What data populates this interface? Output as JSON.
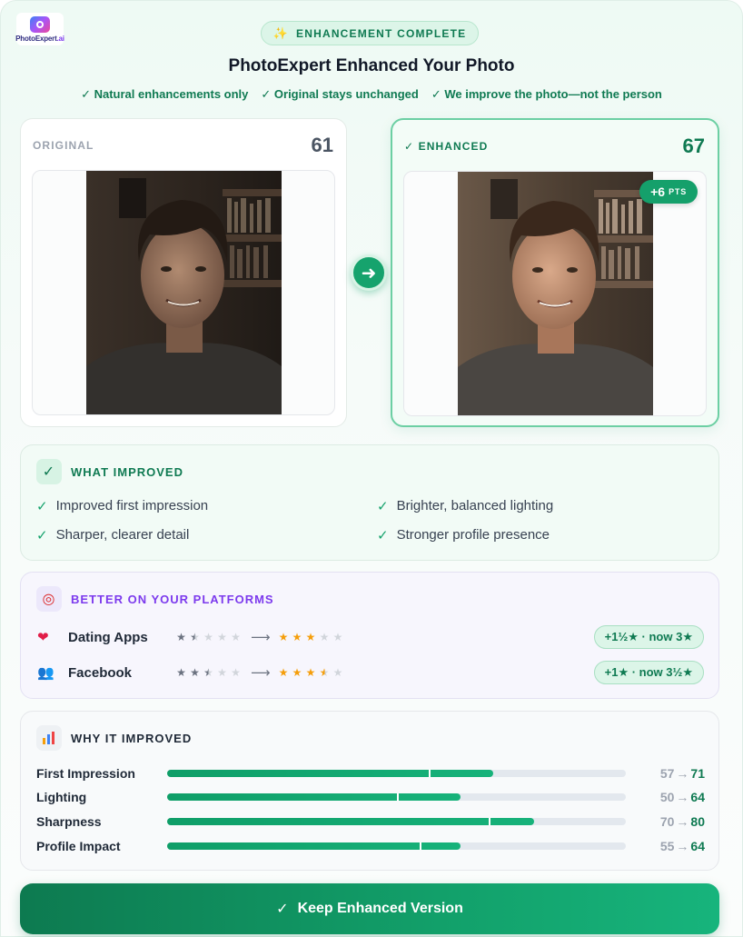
{
  "brand": {
    "logo_text": "PhotoExpert",
    "logo_suffix": ".ai"
  },
  "status_pill": {
    "icon": "sparkle-icon",
    "label": "ENHANCEMENT COMPLETE"
  },
  "title": "PhotoExpert Enhanced Your Photo",
  "promises": [
    "✓ Natural enhancements only",
    "✓ Original stays unchanged",
    "✓ We improve the photo—not the person"
  ],
  "original": {
    "label": "ORIGINAL",
    "score": "61"
  },
  "enhanced": {
    "label": "✓ ENHANCED",
    "score": "67",
    "delta": "+6",
    "delta_unit": "PTS"
  },
  "improved": {
    "heading": "WHAT IMPROVED",
    "items": [
      "Improved first impression",
      "Brighter, balanced lighting",
      "Sharper, clearer detail",
      "Stronger profile presence"
    ]
  },
  "platforms": {
    "heading": "BETTER ON YOUR PLATFORMS",
    "rows": [
      {
        "name": "Dating Apps",
        "icon": "heart-icon",
        "before_stars": 1.5,
        "after_stars": 3,
        "badge": "+1½★ · now 3★"
      },
      {
        "name": "Facebook",
        "icon": "people-icon",
        "before_stars": 2.5,
        "after_stars": 3.5,
        "badge": "+1★ · now 3½★"
      }
    ]
  },
  "why": {
    "heading": "WHY IT IMPROVED",
    "rows": [
      {
        "label": "First Impression",
        "before": 57,
        "after": 71
      },
      {
        "label": "Lighting",
        "before": 50,
        "after": 64
      },
      {
        "label": "Sharpness",
        "before": 70,
        "after": 80
      },
      {
        "label": "Profile Impact",
        "before": 55,
        "after": 64
      }
    ]
  },
  "cta": {
    "label": "Keep Enhanced Version"
  },
  "colors": {
    "accent": "#16a36d",
    "accent_dark": "#0d7a50",
    "platform_accent": "#7c3aed",
    "star": "#f59e0b"
  }
}
